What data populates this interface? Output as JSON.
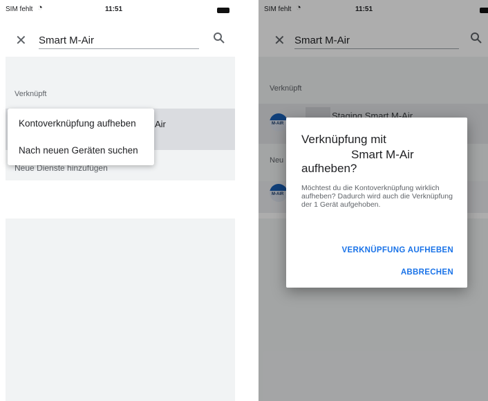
{
  "status_bar": {
    "carrier": "SIM fehlt",
    "wifi_icon": "wifi-icon",
    "time": "11:51",
    "battery_icon": "battery-icon"
  },
  "search": {
    "query": "Smart M-Air",
    "close_icon": "close-icon",
    "search_icon": "search-icon"
  },
  "sections": {
    "linked": "Verknüpft",
    "new_services": "Neue Dienste hinzufügen",
    "new_short": "Neu"
  },
  "left": {
    "selected_row_text": "Air",
    "menu": {
      "unlink": "Kontoverknüpfung aufheben",
      "search_devices": "Nach neuen Geräten suchen"
    }
  },
  "right": {
    "linked_item": "Staging Smart M-Air",
    "logo_text": "M-AIR",
    "dialog": {
      "title_line1": "Verknüpfung mit",
      "title_line2": "Smart M-Air",
      "title_line3": "aufheben?",
      "body": "Möchtest du die Kontoverknüpfung wirklich aufheben? Dadurch wird auch die Verknüpfung der 1 Gerät aufgehoben.",
      "confirm": "VERKNÜPFUNG AUFHEBEN",
      "cancel": "ABBRECHEN"
    }
  },
  "colors": {
    "accent": "#1a73e8",
    "gray_band": "#f1f3f4",
    "selected_row": "#dadce0"
  }
}
